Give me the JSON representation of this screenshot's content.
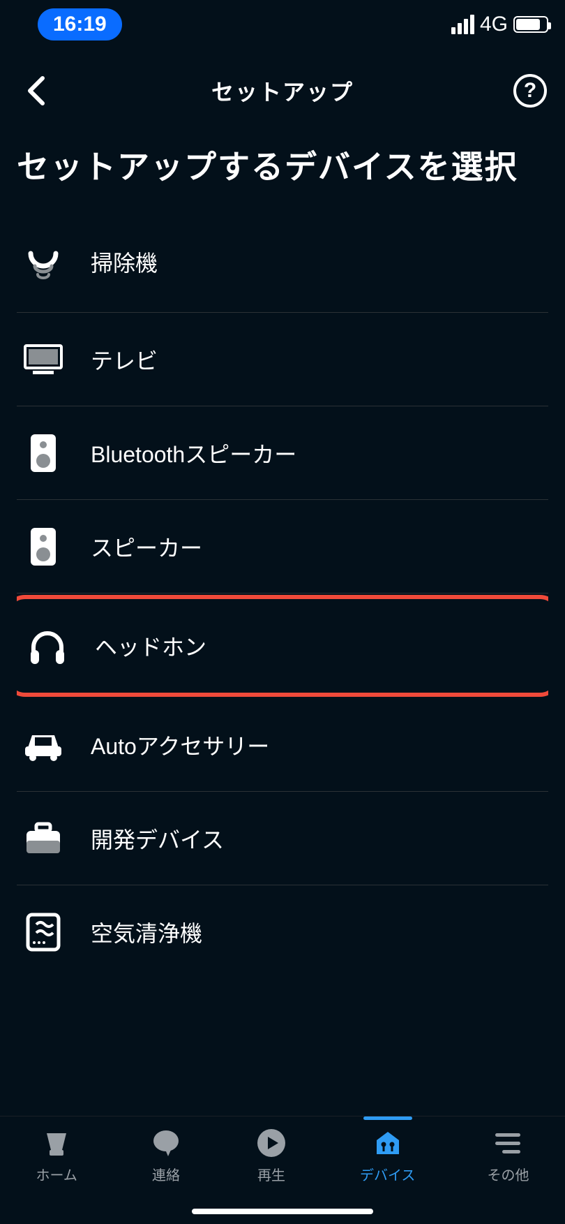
{
  "status": {
    "time": "16:19",
    "network": "4G"
  },
  "nav": {
    "title": "セットアップ"
  },
  "heading": "セットアップするデバイスを選択",
  "devices": [
    {
      "label": "掃除機"
    },
    {
      "label": "テレビ"
    },
    {
      "label": "Bluetoothスピーカー"
    },
    {
      "label": "スピーカー"
    },
    {
      "label": "ヘッドホン"
    },
    {
      "label": "Autoアクセサリー"
    },
    {
      "label": "開発デバイス"
    },
    {
      "label": "空気清浄機"
    }
  ],
  "tabs": [
    {
      "label": "ホーム"
    },
    {
      "label": "連絡"
    },
    {
      "label": "再生"
    },
    {
      "label": "デバイス"
    },
    {
      "label": "その他"
    }
  ]
}
